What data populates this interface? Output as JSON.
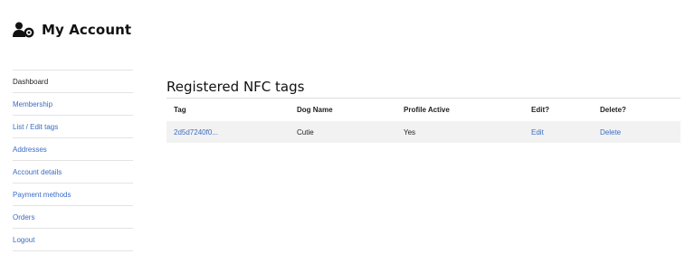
{
  "header": {
    "title": "My Account",
    "icon": "user-settings-icon"
  },
  "sidebar": {
    "items": [
      {
        "label": "Dashboard",
        "active": true
      },
      {
        "label": "Membership"
      },
      {
        "label": "List / Edit tags"
      },
      {
        "label": "Addresses"
      },
      {
        "label": "Account details"
      },
      {
        "label": "Payment methods"
      },
      {
        "label": "Orders"
      },
      {
        "label": "Logout"
      }
    ]
  },
  "main": {
    "heading": "Registered NFC tags",
    "table": {
      "columns": [
        "Tag",
        "Dog Name",
        "Profile Active",
        "Edit?",
        "Delete?"
      ],
      "rows": [
        {
          "tag": "2d5d7240f0...",
          "dog_name": "Cutie",
          "profile_active": "Yes",
          "edit": "Edit",
          "delete": "Delete"
        }
      ]
    }
  },
  "colors": {
    "link": "#3b6cc6",
    "row_bg": "#f2f2f2",
    "divider": "#e3e3e3"
  }
}
